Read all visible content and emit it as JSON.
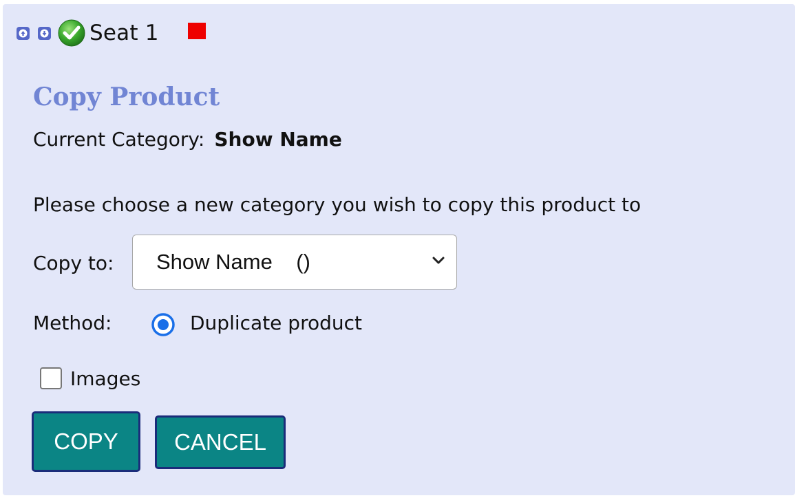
{
  "header": {
    "move_up_icon": "arrow-up-icon",
    "move_down_icon": "arrow-down-icon",
    "status_icon": "green-check-icon",
    "seat_label": "Seat 1",
    "status_color": "#ee0000"
  },
  "form": {
    "title": "Copy Product",
    "current_category_label": "Current Category:",
    "current_category_value": "Show Name",
    "instruction": "Please choose a new category you wish to copy this product to",
    "copy_to_label": "Copy to:",
    "copy_to_selected": "Show Name    ()",
    "method_label": "Method:",
    "method_option": "Duplicate product",
    "method_selected": true,
    "images_label": "Images",
    "images_checked": false
  },
  "buttons": {
    "copy": "COPY",
    "cancel": "CANCEL"
  },
  "colors": {
    "panel_bg": "#e3e7f9",
    "title": "#7185d4",
    "button_bg": "#0b8585",
    "button_border": "#1a2c7a",
    "radio_accent": "#1a6fe8"
  }
}
